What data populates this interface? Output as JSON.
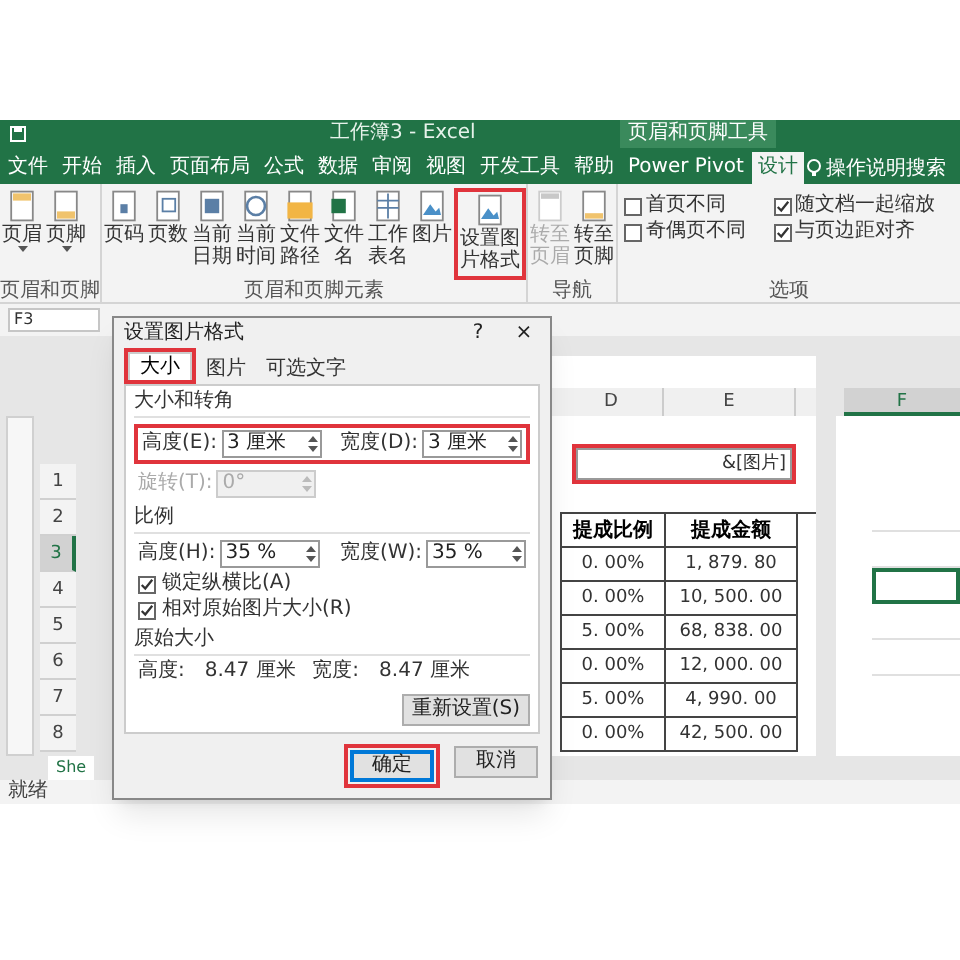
{
  "window": {
    "title": "工作簿3 - Excel",
    "context_title": "页眉和页脚工具"
  },
  "tabs": [
    {
      "label": "文件",
      "selected": false
    },
    {
      "label": "开始",
      "selected": false
    },
    {
      "label": "插入",
      "selected": false
    },
    {
      "label": "页面布局",
      "selected": false
    },
    {
      "label": "公式",
      "selected": false
    },
    {
      "label": "数据",
      "selected": false
    },
    {
      "label": "审阅",
      "selected": false
    },
    {
      "label": "视图",
      "selected": false
    },
    {
      "label": "开发工具",
      "selected": false
    },
    {
      "label": "帮助",
      "selected": false
    },
    {
      "label": "Power Pivot",
      "selected": false
    },
    {
      "label": "设计",
      "selected": true
    }
  ],
  "tell_me": "操作说明搜索",
  "ribbon": {
    "groups": [
      {
        "label": "页眉和页脚",
        "buttons": [
          {
            "label": "页眉",
            "kind": "header",
            "dropdown": true,
            "disabled": false,
            "highlighted": false
          },
          {
            "label": "页脚",
            "kind": "footer",
            "dropdown": true,
            "disabled": false,
            "highlighted": false
          }
        ]
      },
      {
        "label": "页眉和页脚元素",
        "buttons": [
          {
            "label": "页码",
            "kind": "page-number",
            "dropdown": false,
            "disabled": false,
            "highlighted": false
          },
          {
            "label": "页数",
            "kind": "page-count",
            "dropdown": false,
            "disabled": false,
            "highlighted": false
          },
          {
            "label": "当前日期",
            "kind": "date",
            "dropdown": false,
            "disabled": false,
            "highlighted": false
          },
          {
            "label": "当前时间",
            "kind": "time",
            "dropdown": false,
            "disabled": false,
            "highlighted": false
          },
          {
            "label": "文件路径",
            "kind": "folder",
            "dropdown": false,
            "disabled": false,
            "highlighted": false
          },
          {
            "label": "文件名",
            "kind": "excel-file",
            "dropdown": false,
            "disabled": false,
            "highlighted": false
          },
          {
            "label": "工作表名",
            "kind": "sheet",
            "dropdown": false,
            "disabled": false,
            "highlighted": false
          },
          {
            "label": "图片",
            "kind": "picture",
            "dropdown": false,
            "disabled": false,
            "highlighted": false
          },
          {
            "label": "设置图片格式",
            "kind": "format",
            "dropdown": false,
            "disabled": false,
            "highlighted": true
          }
        ]
      },
      {
        "label": "导航",
        "buttons": [
          {
            "label": "转至页眉",
            "kind": "goto-header",
            "dropdown": false,
            "disabled": true,
            "highlighted": false
          },
          {
            "label": "转至页脚",
            "kind": "goto-footer",
            "dropdown": false,
            "disabled": false,
            "highlighted": false
          }
        ]
      }
    ],
    "options": {
      "label": "选项",
      "checkboxes": [
        {
          "label": "首页不同",
          "checked": false
        },
        {
          "label": "奇偶页不同",
          "checked": false
        },
        {
          "label": "随文档一起缩放",
          "checked": true
        },
        {
          "label": "与页边距对齐",
          "checked": true
        }
      ]
    }
  },
  "name_box": "F3",
  "sheet": {
    "columns": [
      "D",
      "E"
    ],
    "right_columns": [
      {
        "label": "F",
        "selected": true
      }
    ],
    "header_field": {
      "text": "&[图片]",
      "highlighted": true
    },
    "table": {
      "columns": [
        "提成比例",
        "提成金额"
      ],
      "rows": [
        [
          "0. 00%",
          "1, 879. 80"
        ],
        [
          "0. 00%",
          "10, 500. 00"
        ],
        [
          "5. 00%",
          "68, 838. 00"
        ],
        [
          "0. 00%",
          "12, 000. 00"
        ],
        [
          "5. 00%",
          "4, 990. 00"
        ],
        [
          "0. 00%",
          "42, 500. 00"
        ]
      ]
    },
    "row_numbers": [
      {
        "label": "1",
        "selected": false
      },
      {
        "label": "2",
        "selected": false
      },
      {
        "label": "3",
        "selected": true
      },
      {
        "label": "4",
        "selected": false
      },
      {
        "label": "5",
        "selected": false
      },
      {
        "label": "6",
        "selected": false
      },
      {
        "label": "7",
        "selected": false
      },
      {
        "label": "8",
        "selected": false
      }
    ],
    "sheet_tab": "She",
    "status": "就绪"
  },
  "dialog": {
    "title": "设置图片格式",
    "help": "?",
    "close": "×",
    "tabs": [
      {
        "label": "大小",
        "selected": true,
        "highlighted": true
      },
      {
        "label": "图片",
        "selected": false,
        "highlighted": false
      },
      {
        "label": "可选文字",
        "selected": false,
        "highlighted": false
      }
    ],
    "size_section": "大小和转角",
    "size_row": {
      "highlighted": true,
      "fields": [
        {
          "label": "高度(E):",
          "value": "3 厘米"
        },
        {
          "label": "宽度(D):",
          "value": "3 厘米"
        }
      ]
    },
    "rotation": {
      "label": "旋转(T):",
      "value": "0°",
      "disabled": true
    },
    "scale_section": "比例",
    "scale_fields": [
      {
        "label": "高度(H):",
        "value": "35 %"
      },
      {
        "label": "宽度(W):",
        "value": "35 %"
      }
    ],
    "checkboxes": [
      {
        "label": "锁定纵横比(A)",
        "checked": true
      },
      {
        "label": "相对原始图片大小(R)",
        "checked": true
      }
    ],
    "original_section": "原始大小",
    "original": [
      {
        "label": "高度:",
        "value": "8.47 厘米"
      },
      {
        "label": "宽度:",
        "value": "8.47 厘米"
      }
    ],
    "reset": "重新设置(S)",
    "buttons": [
      {
        "label": "确定",
        "default": true,
        "highlighted": true
      },
      {
        "label": "取消",
        "default": false,
        "highlighted": false
      }
    ]
  }
}
